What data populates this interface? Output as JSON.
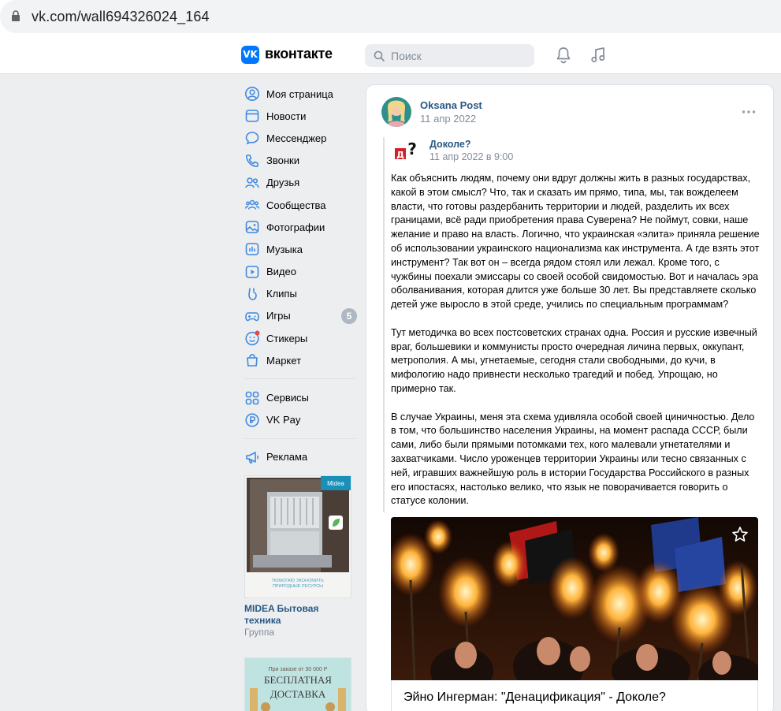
{
  "browser": {
    "url": "vk.com/wall694326024_164"
  },
  "header": {
    "logo_mark": "VK",
    "logo_text": "вконтакте",
    "search_placeholder": "Поиск"
  },
  "sidebar": {
    "items": [
      {
        "label": "Моя страница",
        "icon": "user-circle-icon"
      },
      {
        "label": "Новости",
        "icon": "news-icon"
      },
      {
        "label": "Мессенджер",
        "icon": "message-icon"
      },
      {
        "label": "Звонки",
        "icon": "phone-icon"
      },
      {
        "label": "Друзья",
        "icon": "friends-icon"
      },
      {
        "label": "Сообщества",
        "icon": "communities-icon"
      },
      {
        "label": "Фотографии",
        "icon": "photos-icon"
      },
      {
        "label": "Музыка",
        "icon": "music-icon"
      },
      {
        "label": "Видео",
        "icon": "video-icon"
      },
      {
        "label": "Клипы",
        "icon": "clips-icon"
      },
      {
        "label": "Игры",
        "icon": "games-icon",
        "badge": "5"
      },
      {
        "label": "Стикеры",
        "icon": "stickers-icon"
      },
      {
        "label": "Маркет",
        "icon": "market-icon"
      }
    ],
    "items2": [
      {
        "label": "Сервисы",
        "icon": "services-icon"
      },
      {
        "label": "VK Pay",
        "icon": "vkpay-icon"
      }
    ],
    "items3": [
      {
        "label": "Реклама",
        "icon": "megaphone-icon"
      }
    ],
    "ad1": {
      "brand_badge": "Midea",
      "banner_text": "ПОМОГАЮ ЭКОНОМИТЬ ПРИРОДНЫЕ РЕСУРСЫ",
      "title": "MIDEA Бытовая техника",
      "subtitle": "Группа"
    },
    "ad2": {
      "top_text": "При заказе от 30 000 Р",
      "big_text_1": "БЕСПЛАТНАЯ",
      "big_text_2": "ДОСТАВКА"
    }
  },
  "post": {
    "author": "Oksana Post",
    "date": "11 апр 2022",
    "repost": {
      "author": "Доколе?",
      "date": "11 апр 2022 в 9:00"
    },
    "paragraphs": [
      "Как объяснить людям, почему они вдруг должны жить в разных государствах, какой в этом смысл? Что, так и сказать им прямо, типа, мы, так вожделеем власти, что готовы раздербанить территории и людей, разделить их всех границами, всё ради приобретения права Суверена? Не поймут, совки, наше желание и право на власть. Логично, что украинская «элита» приняла решение об использовании украинского национализма как инструмента. А где взять этот инструмент? Так вот он – всегда рядом стоял или лежал. Кроме того, с чужбины поехали эмиссары со своей особой свидомостью. Вот и началась эра оболванивания, которая длится уже больше 30 лет. Вы представляете сколько детей уже выросло в этой среде, учились по специальным программам?",
      "Тут методичка во всех постсоветских странах одна. Россия и русские извечный враг, большевики и коммунисты просто очередная личина первых, оккупант, метрополия. А мы, угнетаемые, сегодня стали свободными, до кучи, в мифологию надо привнести несколько трагедий и побед. Упрощаю, но примерно так.",
      "В случае Украины, меня эта схема удивляла особой своей циничностью. Дело в том, что большинство населения Украины, на момент распада СССР, были сами, либо были прямыми потомками тех, кого малевали угнетателями и захватчиками. Число уроженцев территории Украины или тесно связанных с ней, игравших важнейшую роль в истории Государства Российского в разных его ипостасях, настолько велико, что язык не поворачивается говорить о статусе колонии."
    ],
    "link_title": "Эйно Ингерман: \"Денацификация\" - Доколе?"
  },
  "colors": {
    "accent": "#0077ff",
    "link": "#2a5885",
    "muted": "#818c99",
    "page_bg": "#edeef0"
  }
}
